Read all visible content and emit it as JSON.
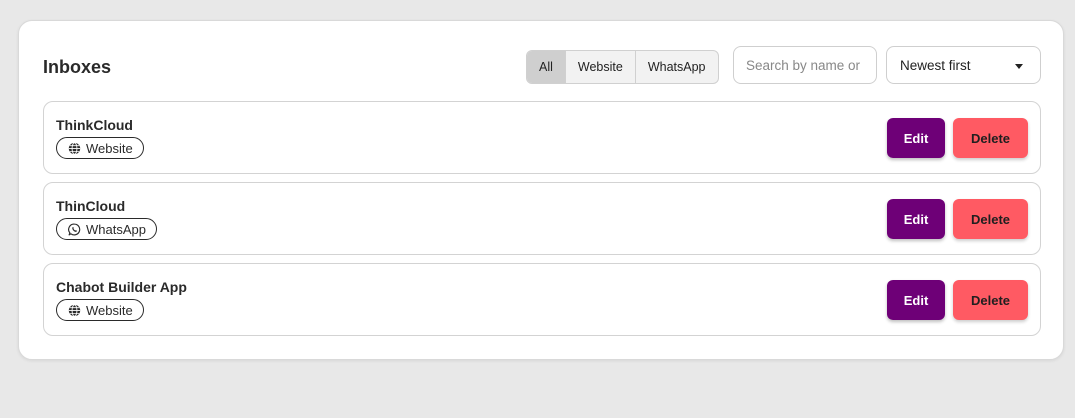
{
  "header": {
    "title": "Inboxes"
  },
  "filters": [
    {
      "label": "All",
      "active": true
    },
    {
      "label": "Website",
      "active": false
    },
    {
      "label": "WhatsApp",
      "active": false
    }
  ],
  "search": {
    "value": "",
    "placeholder": "Search by name or"
  },
  "sort": {
    "selected": "Newest first"
  },
  "inboxes": [
    {
      "name": "ThinkCloud",
      "channel": "Website",
      "channel_icon": "globe-icon",
      "edit_label": "Edit",
      "delete_label": "Delete"
    },
    {
      "name": "ThinCloud",
      "channel": "WhatsApp",
      "channel_icon": "whatsapp-icon",
      "edit_label": "Edit",
      "delete_label": "Delete"
    },
    {
      "name": "Chabot Builder App",
      "channel": "Website",
      "channel_icon": "globe-icon",
      "edit_label": "Edit",
      "delete_label": "Delete"
    }
  ],
  "colors": {
    "edit_button": "#6e0077",
    "delete_button": "#ff5a63",
    "page_background": "#e8e8e8"
  }
}
